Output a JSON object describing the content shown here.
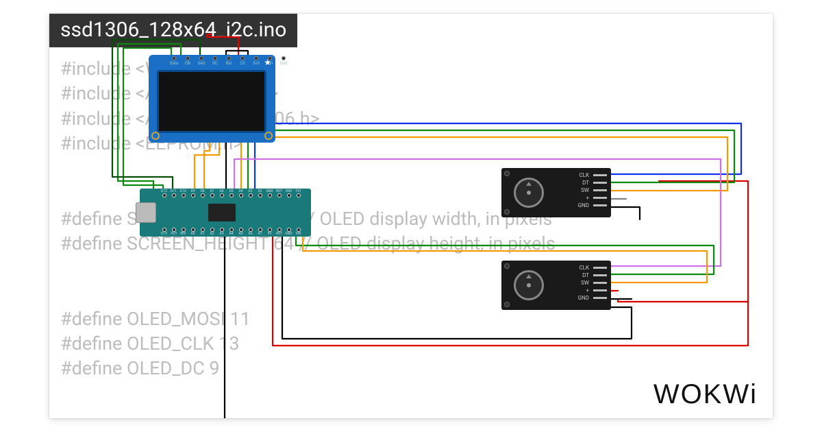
{
  "title": "ssd1306_128x64_i2c.ino",
  "brand": "WOKWi",
  "code_lines": [
    "#include <Wire.h>",
    "#include <Adafruit_GFX.h>",
    "#include <Adafruit_SSD1306.h>",
    "#include <EEPROM.h>",
    "",
    "",
    "#define SCREEN_WIDTH 128 // OLED display width, in pixels",
    "#define SCREEN_HEIGHT 64 // OLED display height, in pixels",
    "",
    "",
    "#define OLED_MOSI 11",
    "#define OLED_CLK 13",
    "#define OLED_DC 9"
  ],
  "oled": {
    "pins": [
      "Data",
      "Clk",
      "SA0",
      "DC",
      "Rst",
      "CS",
      "3v3",
      "Vin",
      "Gnd"
    ]
  },
  "nano": {
    "top_pins": [
      "D12",
      "D11",
      "D10",
      "D9",
      "D8",
      "D7",
      "D6",
      "D5",
      "D4",
      "D3",
      "D2",
      "GND",
      "RST",
      "RX0",
      "TX1"
    ],
    "bot_pins": [
      "D13",
      "3V3",
      "REF",
      "A0",
      "A1",
      "A2",
      "A3",
      "A4",
      "A5",
      "A6",
      "A7",
      "5V",
      "RST",
      "GND",
      "VIN"
    ]
  },
  "encoder": {
    "pins": [
      "CLK",
      "DT",
      "SW",
      "+",
      "GND"
    ]
  },
  "wire_colors": {
    "power_5v": "#e00000",
    "ground": "#000000",
    "data_green": "#0a8a0a",
    "clk_blue": "#1030f0",
    "sw_orange": "#f59b00",
    "alt_violet": "#d070e8",
    "misc_gray": "#808080"
  }
}
